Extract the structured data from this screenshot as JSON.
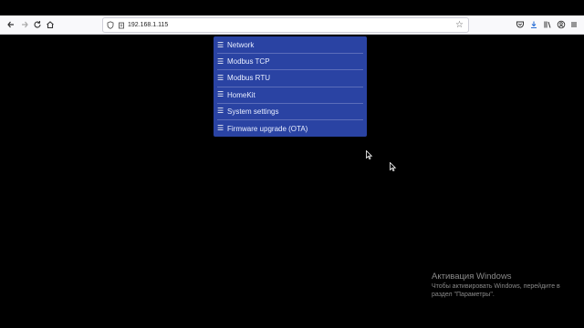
{
  "browser": {
    "url": "192.168.1.115"
  },
  "menu": {
    "items": [
      {
        "icon": "menu-icon",
        "label": "Network"
      },
      {
        "icon": "menu-icon",
        "label": "Modbus TCP"
      },
      {
        "icon": "menu-icon",
        "label": "Modbus RTU"
      },
      {
        "icon": "menu-icon",
        "label": "HomeKit"
      },
      {
        "icon": "menu-icon",
        "label": "System settings"
      },
      {
        "icon": "menu-icon",
        "label": "Firmware upgrade (OTA)"
      }
    ]
  },
  "watermark": {
    "title": "Активация Windows",
    "line1": "Чтобы активировать Windows, перейдите в",
    "line2": "раздел \"Параметры\"."
  },
  "colors": {
    "menu_bg": "#2a43a3",
    "page_bg": "#000000"
  }
}
